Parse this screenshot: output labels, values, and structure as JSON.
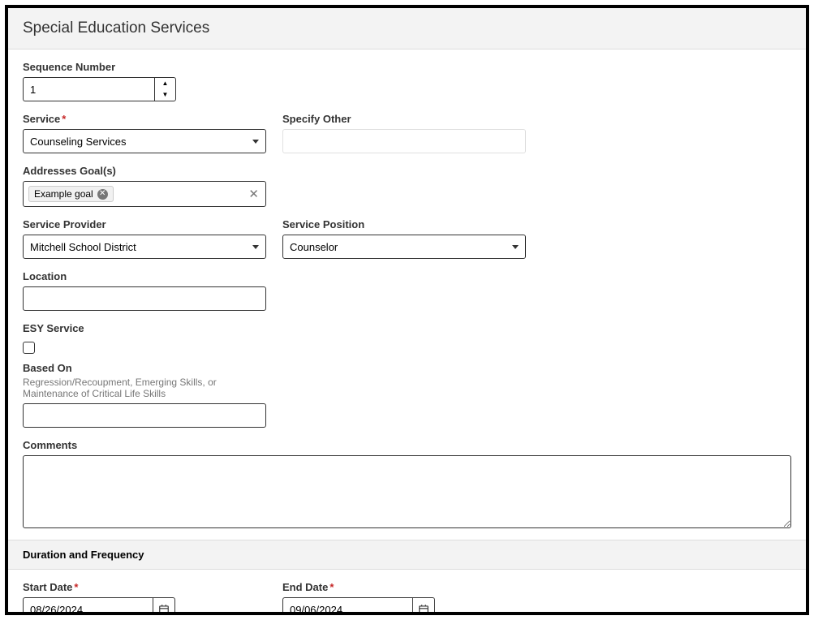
{
  "header": {
    "title": "Special Education Services"
  },
  "fields": {
    "sequence_number_label": "Sequence Number",
    "sequence_number_value": "1",
    "service_label": "Service",
    "service_value": "Counseling Services",
    "specify_other_label": "Specify Other",
    "specify_other_value": "",
    "addresses_goals_label": "Addresses Goal(s)",
    "goal_chip": "Example goal",
    "service_provider_label": "Service Provider",
    "service_provider_value": "Mitchell School District",
    "service_position_label": "Service Position",
    "service_position_value": "Counselor",
    "location_label": "Location",
    "location_value": "",
    "esy_label": "ESY Service",
    "based_on_label": "Based On",
    "based_on_help": "Regression/Recoupment, Emerging Skills, or Maintenance of Critical Life Skills",
    "based_on_value": "",
    "comments_label": "Comments",
    "comments_value": ""
  },
  "subsection": {
    "title": "Duration and Frequency"
  },
  "dates": {
    "start_label": "Start Date",
    "start_value": "08/26/2024",
    "end_label": "End Date",
    "end_value": "09/06/2024"
  },
  "icons": {
    "chip_close": "✕",
    "clear": "✕",
    "up": "▲",
    "down": "▼"
  }
}
